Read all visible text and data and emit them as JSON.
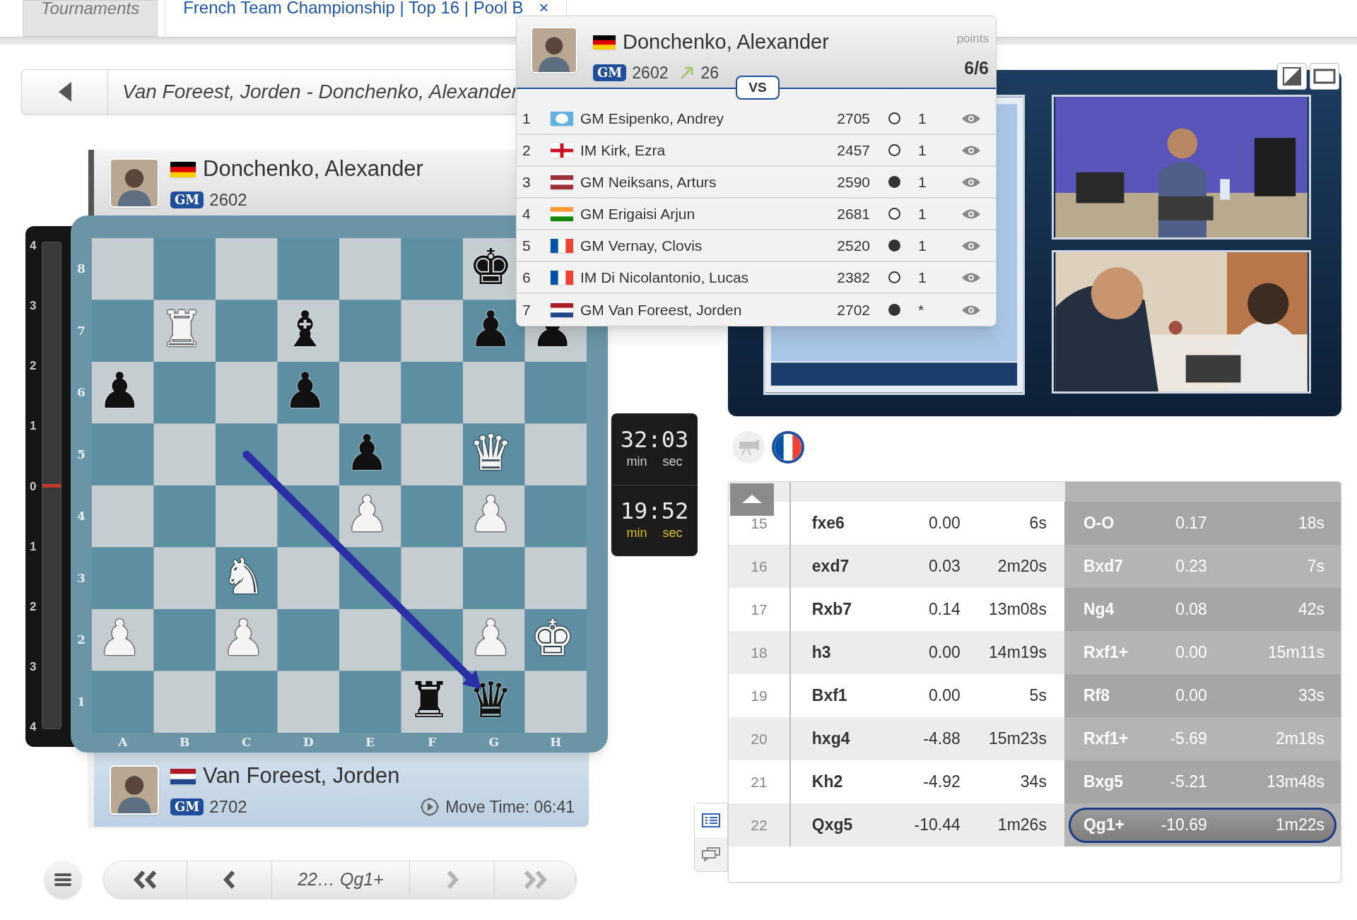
{
  "tabs": [
    {
      "label": "Tournaments",
      "selected": false
    },
    {
      "label": "French Team Championship | Top 16 | Pool B",
      "selected": true,
      "close_label": "×"
    }
  ],
  "game_bar": {
    "title": "Van Foreest, Jorden - Donchenko, Alexander"
  },
  "top_player": {
    "name": "Donchenko, Alexander",
    "title": "GM",
    "rating": "2602",
    "to_move": false,
    "flag": {
      "kind": "germany"
    }
  },
  "eval_scale": [
    "4",
    "3",
    "2",
    "1",
    "0",
    "1",
    "2",
    "3",
    "4"
  ],
  "board": {
    "ranks": [
      "8",
      "7",
      "6",
      "5",
      "4",
      "3",
      "2",
      "1"
    ],
    "files": [
      "A",
      "B",
      "C",
      "D",
      "E",
      "F",
      "G",
      "H"
    ],
    "squares": [
      [
        {
          "kind": "empty"
        },
        {
          "kind": "empty"
        },
        {
          "kind": "empty"
        },
        {
          "kind": "empty"
        },
        {
          "kind": "empty"
        },
        {
          "kind": "empty"
        },
        {
          "glyph": "♚",
          "kind": "black"
        },
        {
          "kind": "empty"
        }
      ],
      [
        {
          "kind": "empty"
        },
        {
          "glyph": "♜",
          "kind": "white"
        },
        {
          "kind": "empty"
        },
        {
          "glyph": "♝",
          "kind": "black"
        },
        {
          "kind": "empty"
        },
        {
          "kind": "empty"
        },
        {
          "glyph": "♟",
          "kind": "black"
        },
        {
          "glyph": "♟",
          "kind": "black"
        }
      ],
      [
        {
          "glyph": "♟",
          "kind": "black"
        },
        {
          "kind": "empty"
        },
        {
          "kind": "empty"
        },
        {
          "glyph": "♟",
          "kind": "black"
        },
        {
          "kind": "empty"
        },
        {
          "kind": "empty"
        },
        {
          "kind": "empty"
        },
        {
          "kind": "empty"
        }
      ],
      [
        {
          "kind": "empty"
        },
        {
          "kind": "empty"
        },
        {
          "kind": "empty"
        },
        {
          "kind": "empty"
        },
        {
          "glyph": "♟",
          "kind": "black"
        },
        {
          "kind": "empty"
        },
        {
          "glyph": "♛",
          "kind": "white"
        },
        {
          "kind": "empty"
        }
      ],
      [
        {
          "kind": "empty"
        },
        {
          "kind": "empty"
        },
        {
          "kind": "empty"
        },
        {
          "kind": "empty"
        },
        {
          "glyph": "♟",
          "kind": "white"
        },
        {
          "kind": "empty"
        },
        {
          "glyph": "♟",
          "kind": "white"
        },
        {
          "kind": "empty"
        }
      ],
      [
        {
          "kind": "empty"
        },
        {
          "kind": "empty"
        },
        {
          "glyph": "♞",
          "kind": "white"
        },
        {
          "kind": "empty"
        },
        {
          "kind": "empty"
        },
        {
          "kind": "empty"
        },
        {
          "kind": "empty"
        },
        {
          "kind": "empty"
        }
      ],
      [
        {
          "glyph": "♟",
          "kind": "white"
        },
        {
          "kind": "empty"
        },
        {
          "glyph": "♟",
          "kind": "white"
        },
        {
          "kind": "empty"
        },
        {
          "kind": "empty"
        },
        {
          "kind": "empty"
        },
        {
          "glyph": "♟",
          "kind": "white"
        },
        {
          "glyph": "♚",
          "kind": "white"
        }
      ],
      [
        {
          "kind": "empty"
        },
        {
          "kind": "empty"
        },
        {
          "kind": "empty"
        },
        {
          "kind": "empty"
        },
        {
          "kind": "empty"
        },
        {
          "glyph": "♜",
          "kind": "black"
        },
        {
          "glyph": "♛",
          "kind": "black"
        },
        {
          "kind": "empty"
        }
      ]
    ]
  },
  "clocks": [
    {
      "time": "32:03",
      "units": [
        "min",
        "sec"
      ],
      "active": false
    },
    {
      "time": "19:52",
      "units": [
        "min",
        "sec"
      ],
      "active": true
    }
  ],
  "bottom_player": {
    "name": "Van Foreest, Jorden",
    "title": "GM",
    "rating": "2702",
    "to_move": true,
    "move_time": "Move Time: 06:41",
    "flag": {
      "kind": "netherlands"
    }
  },
  "navigation": {
    "current": "22… Qg1+",
    "buttons": [
      {
        "kind": "first",
        "disabled": false
      },
      {
        "kind": "prev",
        "disabled": false
      },
      {
        "kind": "next",
        "disabled": true
      },
      {
        "kind": "last",
        "disabled": true
      }
    ]
  },
  "popup": {
    "player": {
      "name": "Donchenko, Alexander",
      "title": "GM",
      "rating": "2602",
      "change": "26",
      "points_label": "points",
      "points": "6/6",
      "flag": {
        "kind": "germany"
      }
    },
    "vs": "VS",
    "rows": [
      {
        "number": "1",
        "name": "GM Esipenko, Andrey",
        "rating": "2705",
        "played_white": true,
        "result": "1",
        "flag": {
          "kind": "fide"
        }
      },
      {
        "number": "2",
        "name": "IM Kirk, Ezra",
        "rating": "2457",
        "played_white": true,
        "result": "1",
        "flag": {
          "kind": "england"
        }
      },
      {
        "number": "3",
        "name": "GM Neiksans, Arturs",
        "rating": "2590",
        "played_white": false,
        "result": "1",
        "flag": {
          "kind": "latvia"
        }
      },
      {
        "number": "4",
        "name": "GM Erigaisi Arjun",
        "rating": "2681",
        "played_white": true,
        "result": "1",
        "flag": {
          "kind": "india"
        }
      },
      {
        "number": "5",
        "name": "GM Vernay, Clovis",
        "rating": "2520",
        "played_white": false,
        "result": "1",
        "flag": {
          "kind": "france"
        }
      },
      {
        "number": "6",
        "name": "IM Di Nicolantonio, Lucas",
        "rating": "2382",
        "played_white": true,
        "result": "1",
        "flag": {
          "kind": "france"
        }
      },
      {
        "number": "7",
        "name": "GM Van Foreest, Jorden",
        "rating": "2702",
        "played_white": false,
        "result": "*",
        "flag": {
          "kind": "netherlands"
        }
      }
    ]
  },
  "video_sources": [
    {
      "kind": "camera",
      "enabled": false,
      "selected": false
    },
    {
      "kind": "flag",
      "enabled": true,
      "selected": true,
      "flag": {
        "kind": "france"
      }
    }
  ],
  "moves": [
    {
      "number": "15",
      "white": {
        "move": "fxe6",
        "eval": "0.00",
        "time": "6s",
        "selected": false
      },
      "black": {
        "move": "O-O",
        "eval": "0.17",
        "time": "18s",
        "selected": false
      }
    },
    {
      "number": "16",
      "white": {
        "move": "exd7",
        "eval": "0.03",
        "time": "2m20s",
        "selected": false
      },
      "black": {
        "move": "Bxd7",
        "eval": "0.23",
        "time": "7s",
        "selected": false
      }
    },
    {
      "number": "17",
      "white": {
        "move": "Rxb7",
        "eval": "0.14",
        "time": "13m08s",
        "selected": false
      },
      "black": {
        "move": "Ng4",
        "eval": "0.08",
        "time": "42s",
        "selected": false
      }
    },
    {
      "number": "18",
      "white": {
        "move": "h3",
        "eval": "0.00",
        "time": "14m19s",
        "selected": false
      },
      "black": {
        "move": "Rxf1+",
        "eval": "0.00",
        "time": "15m11s",
        "selected": false
      }
    },
    {
      "number": "19",
      "white": {
        "move": "Bxf1",
        "eval": "0.00",
        "time": "5s",
        "selected": false
      },
      "black": {
        "move": "Rf8",
        "eval": "0.00",
        "time": "33s",
        "selected": false
      }
    },
    {
      "number": "20",
      "white": {
        "move": "hxg4",
        "eval": "-4.88",
        "time": "15m23s",
        "selected": false
      },
      "black": {
        "move": "Rxf1+",
        "eval": "-5.69",
        "time": "2m18s",
        "selected": false
      }
    },
    {
      "number": "21",
      "white": {
        "move": "Kh2",
        "eval": "-4.92",
        "time": "34s",
        "selected": false
      },
      "black": {
        "move": "Bxg5",
        "eval": "-5.21",
        "time": "13m48s",
        "selected": false
      }
    },
    {
      "number": "22",
      "white": {
        "move": "Qxg5",
        "eval": "-10.44",
        "time": "1m26s",
        "selected": false
      },
      "black": {
        "move": "Qg1+",
        "eval": "-10.69",
        "time": "1m22s",
        "selected": true
      }
    }
  ],
  "side_tabs": [
    {
      "kind": "list",
      "selected": true
    },
    {
      "kind": "chat",
      "selected": false
    }
  ]
}
